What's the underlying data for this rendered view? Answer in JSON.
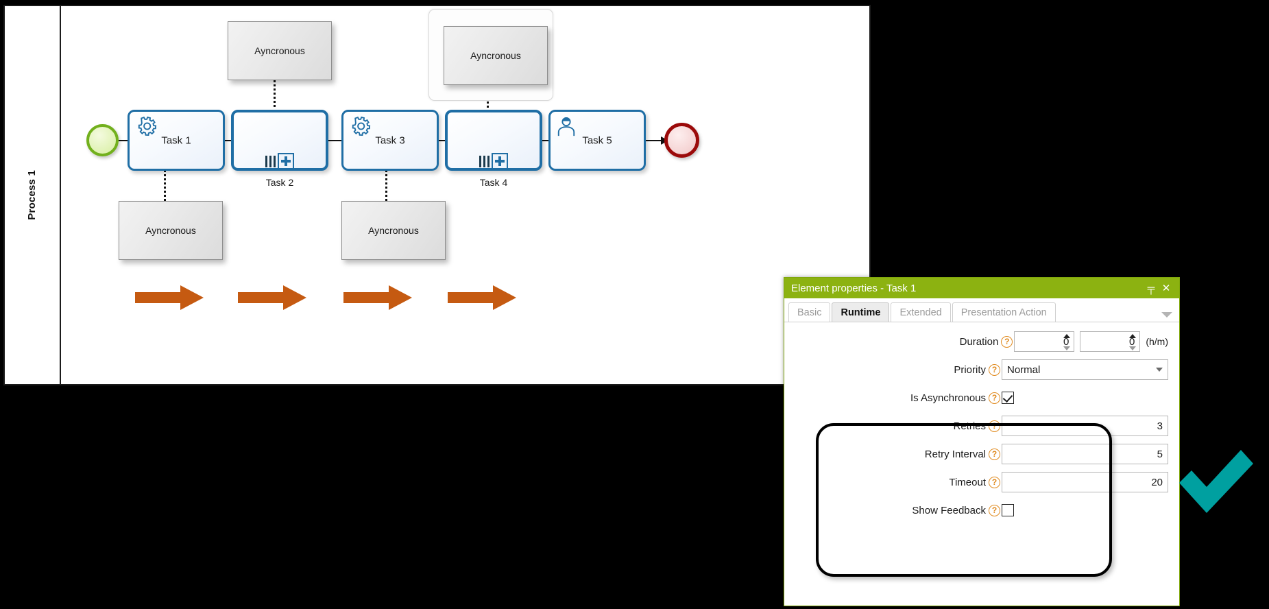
{
  "diagram": {
    "pool_label": "Process 1",
    "start_event": {
      "name": "start-event"
    },
    "end_event": {
      "name": "end-event"
    },
    "tasks": [
      {
        "id": "task1",
        "label": "Task 1",
        "type": "service-task",
        "label_position": "inside"
      },
      {
        "id": "task2",
        "label": "Task 2",
        "type": "sub-process-parallel",
        "label_position": "below"
      },
      {
        "id": "task3",
        "label": "Task 3",
        "type": "service-task",
        "label_position": "inside"
      },
      {
        "id": "task4",
        "label": "Task 4",
        "type": "sub-process-parallel",
        "label_position": "below"
      },
      {
        "id": "task5",
        "label": "Task 5",
        "type": "user-task",
        "label_position": "inside"
      }
    ],
    "annotations": [
      {
        "id": "note-task1",
        "text": "Ayncronous",
        "attached_to": "task1",
        "position": "below",
        "selected": false
      },
      {
        "id": "note-task2",
        "text": "Ayncronous",
        "attached_to": "task2",
        "position": "above",
        "selected": false
      },
      {
        "id": "note-task3",
        "text": "Ayncronous",
        "attached_to": "task3",
        "position": "below",
        "selected": false
      },
      {
        "id": "note-task4",
        "text": "Ayncronous",
        "attached_to": "task4",
        "position": "above",
        "selected": true
      }
    ],
    "emphasis_arrows": {
      "count": 4,
      "color": "#C55A11",
      "direction": "right"
    }
  },
  "properties_panel": {
    "title": "Element properties - Task 1",
    "header_color": "#8CB211",
    "titlebar_buttons": [
      {
        "name": "pin-icon",
        "glyph": "╤"
      },
      {
        "name": "close-icon",
        "glyph": "✕"
      }
    ],
    "tabs": [
      {
        "label": "Basic",
        "active": false
      },
      {
        "label": "Runtime",
        "active": true
      },
      {
        "label": "Extended",
        "active": false
      },
      {
        "label": "Presentation Action",
        "active": false
      }
    ],
    "fields": {
      "duration": {
        "label": "Duration",
        "hours_value": "0",
        "minutes_value": "0",
        "unit": "(h/m)"
      },
      "priority": {
        "label": "Priority",
        "value": "Normal"
      },
      "is_asynchronous": {
        "label": "Is Asynchronous",
        "checked": true
      },
      "retries": {
        "label": "Retries",
        "value": "3"
      },
      "retry_interval": {
        "label": "Retry Interval",
        "value": "5"
      },
      "timeout": {
        "label": "Timeout",
        "value": "20"
      },
      "show_feedback": {
        "label": "Show Feedback",
        "checked": false
      }
    },
    "help_glyph": "?"
  },
  "overlay": {
    "check_mark": {
      "name": "check-mark-icon",
      "color": "#00A0A0"
    }
  }
}
